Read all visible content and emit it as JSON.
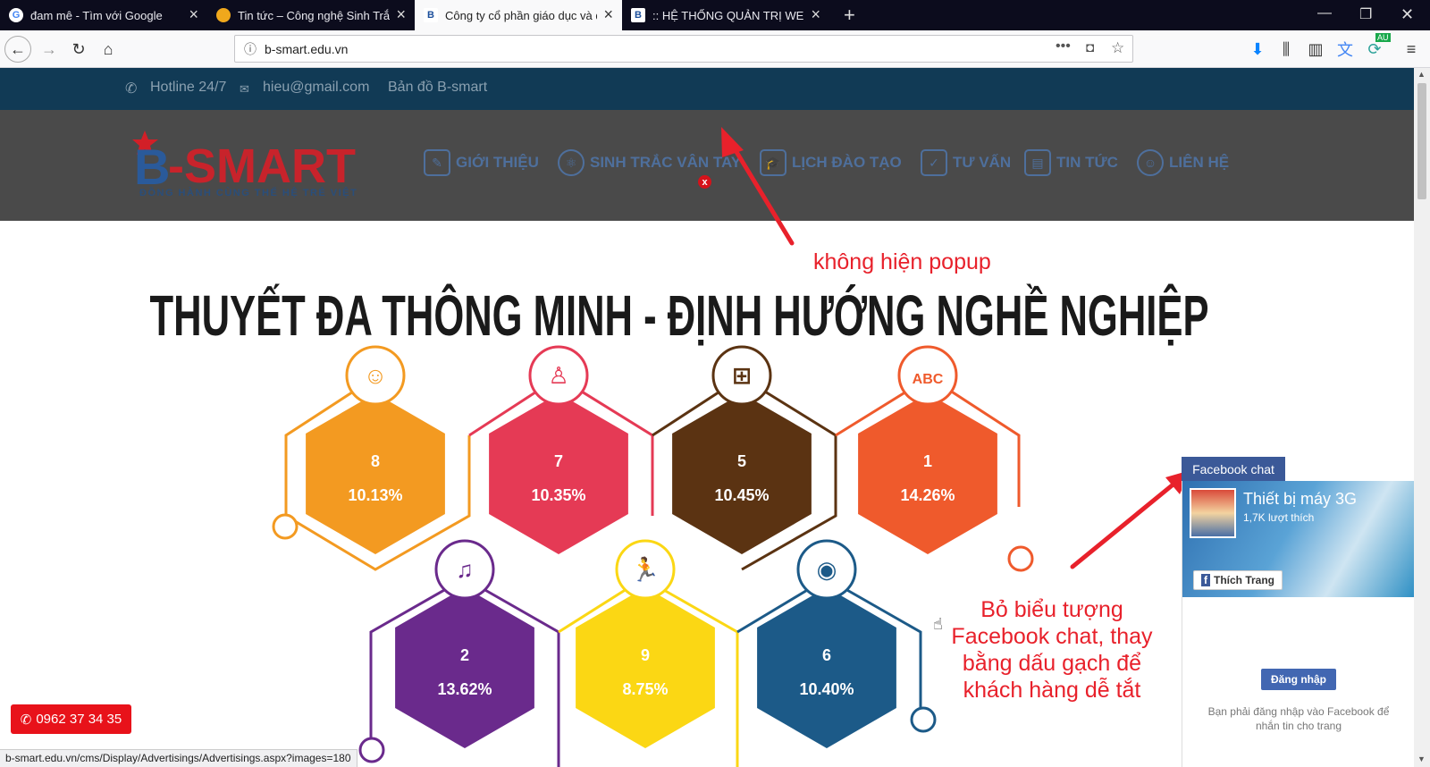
{
  "browser": {
    "tabs": [
      {
        "title": "đam mê - Tìm với Google",
        "icon": "google-icon"
      },
      {
        "title": "Tin tức – Công nghệ Sinh Trắc Dấu Vân Tay",
        "icon": "site-favicon"
      },
      {
        "title": "Công ty cổ phần giáo dục và đào tạo B-Smart",
        "icon": "bsmart-favicon",
        "active": true
      },
      {
        "title": ":: HỆ THỐNG QUẢN TRỊ WEBSITE ::",
        "icon": "bsmart-favicon"
      }
    ],
    "url": "b-smart.edu.vn",
    "status_url": "b-smart.edu.vn/cms/Display/Advertisings/Advertisings.aspx?images=180",
    "sync_badge": "AU"
  },
  "site": {
    "topbar": {
      "hotline": "Hotline 24/7",
      "email": "hieu@gmail.com",
      "map": "Bản đồ B-smart"
    },
    "logo": {
      "name": "B-SMART",
      "slogan": "ĐỒNG HÀNH CÙNG THẾ HỆ TRẺ VIỆT"
    },
    "menu": [
      {
        "label": "GIỚI THIỆU",
        "icon": "notepad-icon"
      },
      {
        "label": "SINH TRẮC VÂN TAY",
        "icon": "atom-icon"
      },
      {
        "label": "LỊCH ĐÀO TẠO",
        "icon": "graduation-icon"
      },
      {
        "label": "TƯ VẤN",
        "icon": "clipboard-icon"
      },
      {
        "label": "TIN TỨC",
        "icon": "news-icon"
      },
      {
        "label": "LIÊN HỆ",
        "icon": "support-icon"
      }
    ],
    "banner": {
      "title": "THUYẾT ĐA THÔNG MINH - ĐỊNH HƯỚNG NGHỀ NGHIỆP",
      "hexagons": [
        {
          "number": "8",
          "percent": "10.13%",
          "color": "#f39a21",
          "icon": "people-icon"
        },
        {
          "number": "7",
          "percent": "10.35%",
          "color": "#e53a55",
          "icon": "group-icon"
        },
        {
          "number": "5",
          "percent": "10.45%",
          "color": "#5b3312",
          "icon": "calculator-icon"
        },
        {
          "number": "1",
          "percent": "14.26%",
          "color": "#ef5a2c",
          "icon": "abc-icon"
        },
        {
          "number": "2",
          "percent": "13.62%",
          "color": "#6a2a8c",
          "icon": "piano-icon"
        },
        {
          "number": "9",
          "percent": "8.75%",
          "color": "#fbd714",
          "icon": "runner-icon"
        },
        {
          "number": "6",
          "percent": "10.40%",
          "color": "#1c5a88",
          "icon": "eye-icon"
        }
      ]
    },
    "hotline_button": "0962 37 34 35",
    "popup_close": "x"
  },
  "facebook": {
    "chat_label": "Facebook chat",
    "page_name": "Thiết bị máy 3G",
    "likes": "1,7K lượt thích",
    "like_button": "Thích Trang",
    "login_button": "Đăng nhập",
    "login_note": "Bạn phải đăng nhập vào Facebook để nhắn tin cho trang"
  },
  "annotations": {
    "popup_note": "không hiện popup",
    "fb_note": [
      "Bỏ biểu tượng",
      "Facebook chat, thay",
      "bằng dấu gạch để",
      "khách hàng dễ tắt"
    ]
  },
  "colors": {
    "annotation": "#e8212b",
    "facebook": "#3b5998",
    "topbar": "#113a55",
    "hotline": "#e8121a"
  }
}
